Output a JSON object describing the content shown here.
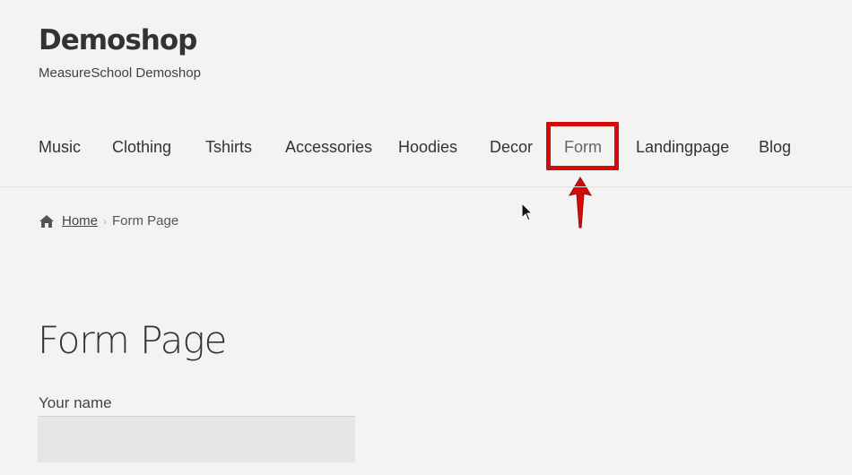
{
  "site": {
    "title": "Demoshop",
    "description": "MeasureSchool Demoshop"
  },
  "nav": {
    "items": [
      {
        "label": "Music"
      },
      {
        "label": "Clothing"
      },
      {
        "label": "Tshirts"
      },
      {
        "label": "Accessories"
      },
      {
        "label": "Hoodies"
      },
      {
        "label": "Decor"
      },
      {
        "label": "Form"
      },
      {
        "label": "Landingpage"
      },
      {
        "label": "Blog"
      }
    ],
    "active": "Form"
  },
  "annotation": {
    "highlight_color": "#d40b0b"
  },
  "breadcrumb": {
    "home_icon": "home-icon",
    "home_label": "Home",
    "separator": "›",
    "current": "Form Page"
  },
  "page": {
    "title": "Form Page"
  },
  "form": {
    "name_label": "Your name",
    "name_value": "",
    "name_placeholder": ""
  }
}
